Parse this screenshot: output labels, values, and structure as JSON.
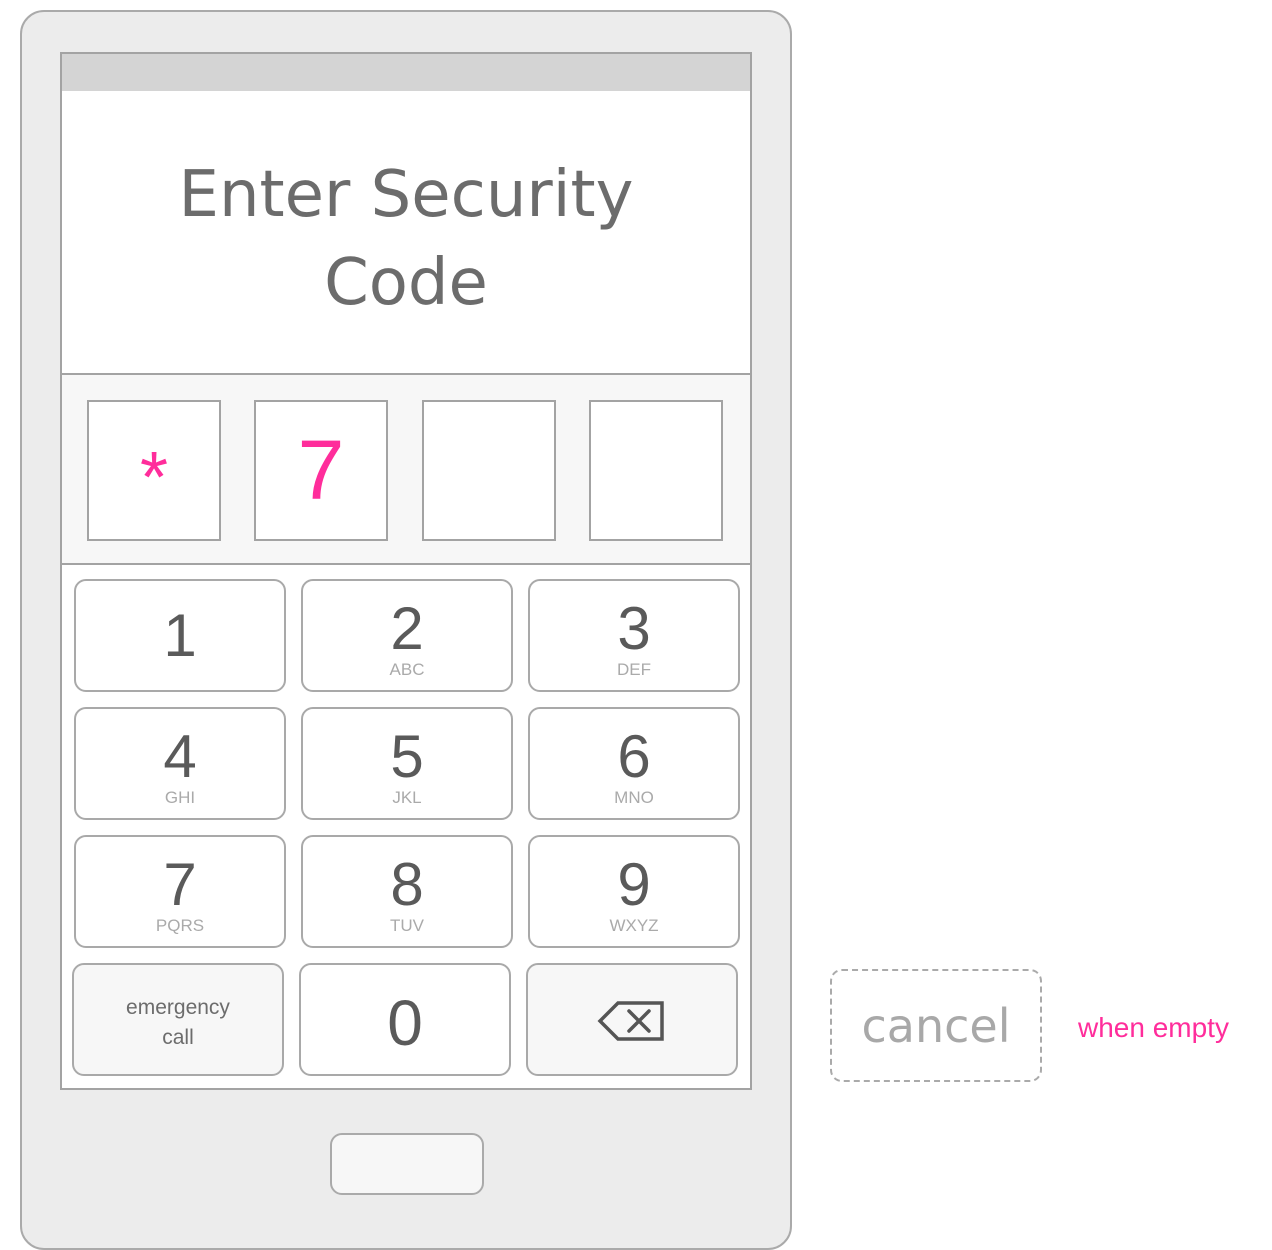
{
  "screen": {
    "title": "Enter Security\nCode"
  },
  "code_entry": {
    "slots": [
      "*",
      "7",
      "",
      ""
    ]
  },
  "keypad": {
    "keys": [
      {
        "digit": "1",
        "letters": ""
      },
      {
        "digit": "2",
        "letters": "ABC"
      },
      {
        "digit": "3",
        "letters": "DEF"
      },
      {
        "digit": "4",
        "letters": "GHI"
      },
      {
        "digit": "5",
        "letters": "JKL"
      },
      {
        "digit": "6",
        "letters": "MNO"
      },
      {
        "digit": "7",
        "letters": "PQRS"
      },
      {
        "digit": "8",
        "letters": "TUV"
      },
      {
        "digit": "9",
        "letters": "WXYZ"
      }
    ],
    "emergency_label": "emergency\ncall",
    "zero_digit": "0",
    "backspace_icon": "backspace-icon"
  },
  "alternate": {
    "cancel_label": "cancel",
    "note": "when empty"
  },
  "colors": {
    "accent": "#ff2d9b"
  }
}
